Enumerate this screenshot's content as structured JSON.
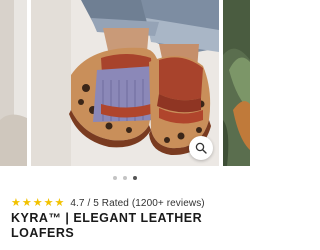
{
  "gallery": {
    "images": [
      "product-photo-left-partial",
      "product-photo-loafers-main",
      "product-photo-right-partial"
    ],
    "zoom_icon": "search-icon"
  },
  "pagination": {
    "count": 3,
    "active_index": 2
  },
  "rating": {
    "stars": 5,
    "star_color": "#f2c200",
    "text": "4.7 / 5 Rated (1200+ reviews)"
  },
  "product": {
    "title": "KYRA™ | ELEGANT LEATHER LOAFERS"
  }
}
